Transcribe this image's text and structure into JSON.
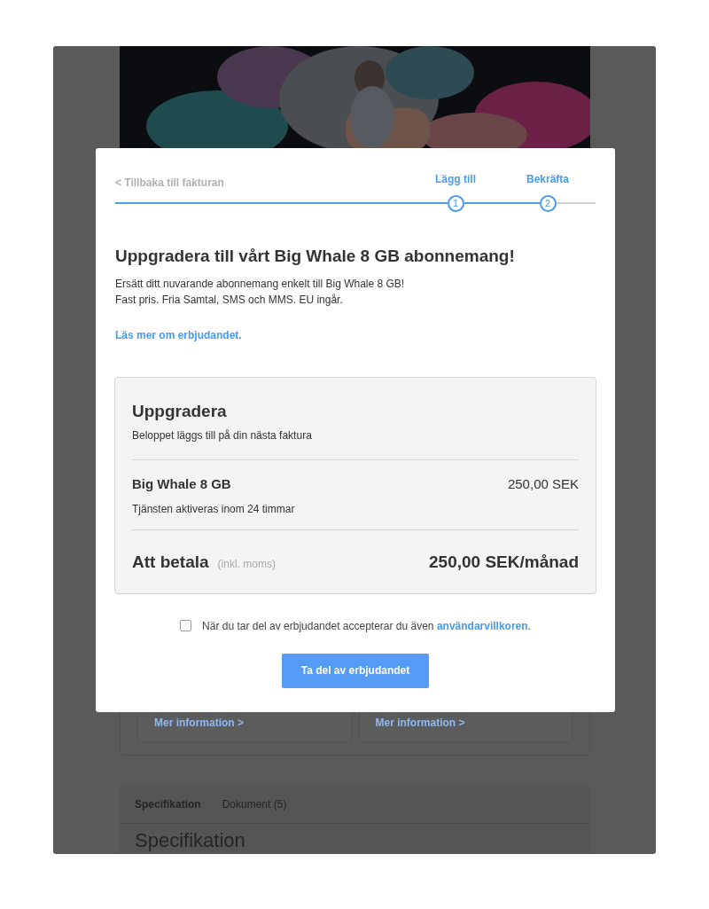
{
  "background": {
    "cards": [
      {
        "link": "Mer information >"
      },
      {
        "link": "Mer information >"
      }
    ],
    "tabs": [
      {
        "label": "Specifikation",
        "selected": true
      },
      {
        "label": "Dokument (5)",
        "selected": false
      }
    ],
    "section_heading": "Specifikation"
  },
  "modal": {
    "back_link": "< Tillbaka till fakturan",
    "steps": [
      {
        "number": "1",
        "label": "Lägg till",
        "active": true
      },
      {
        "number": "2",
        "label": "Bekräfta",
        "active": true
      }
    ],
    "title": "Uppgradera till vårt Big Whale 8 GB abonnemang!",
    "description": [
      "Ersätt ditt nuvarande abonnemang enkelt till Big Whale 8 GB!",
      "Fast pris. Fria Samtal, SMS och MMS. EU ingår."
    ],
    "more_link": "Läs mer om erbjudandet.",
    "summary": {
      "title": "Uppgradera",
      "subtitle": "Beloppet läggs till på din nästa faktura",
      "item": {
        "name": "Big Whale 8 GB",
        "price": "250,00 SEK",
        "note": "Tjänsten aktiveras inom 24 timmar"
      },
      "total": {
        "label": "Att betala",
        "note": "(inkl. moms)",
        "price": "250,00 SEK/månad"
      }
    },
    "terms": {
      "checked": false,
      "text": "När du tar del av erbjudandet accepterar du även ",
      "link": "användarvillkoren",
      "suffix": "."
    },
    "button": "Ta del av erbjudandet"
  }
}
